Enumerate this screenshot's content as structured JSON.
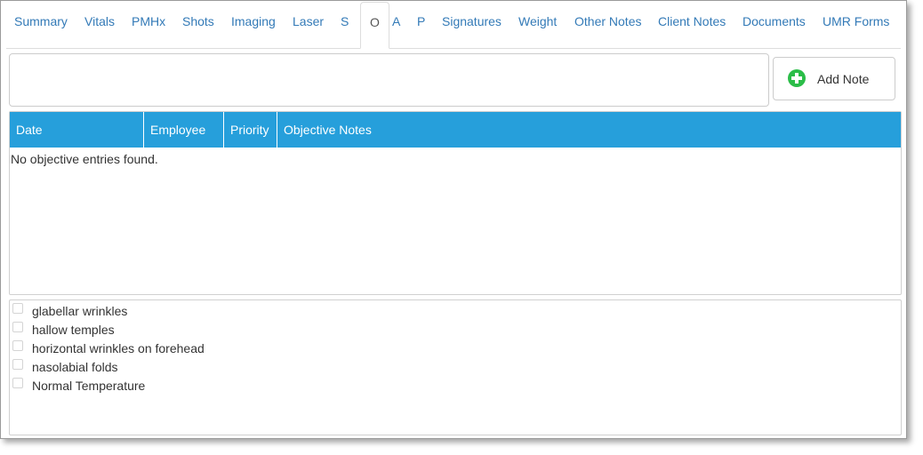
{
  "tabs": [
    {
      "label": "Summary",
      "active": false
    },
    {
      "label": "Vitals",
      "active": false
    },
    {
      "label": "PMHx",
      "active": false
    },
    {
      "label": "Shots",
      "active": false
    },
    {
      "label": "Imaging",
      "active": false
    },
    {
      "label": "Laser",
      "active": false
    },
    {
      "label": "S",
      "active": false
    },
    {
      "label": "O",
      "active": true
    },
    {
      "label": "A",
      "active": false
    },
    {
      "label": "P",
      "active": false
    },
    {
      "label": "Signatures",
      "active": false
    },
    {
      "label": "Weight",
      "active": false
    },
    {
      "label": "Other Notes",
      "active": false
    },
    {
      "label": "Client Notes",
      "active": false
    },
    {
      "label": "Documents",
      "active": false
    },
    {
      "label": "UMR Forms",
      "active": false
    }
  ],
  "note_input": {
    "value": "",
    "placeholder": ""
  },
  "add_note": {
    "label": "Add Note",
    "icon": "plus-circle-icon",
    "icon_color": "#2bbd48"
  },
  "table": {
    "header_color": "#269fdb",
    "columns": [
      "Date",
      "Employee",
      "Priority",
      "Objective Notes"
    ],
    "rows": [],
    "empty_message": "No objective entries found."
  },
  "checklist": {
    "items": [
      {
        "label": "glabellar wrinkles",
        "checked": false
      },
      {
        "label": "hallow temples",
        "checked": false
      },
      {
        "label": "horizontal wrinkles on forehead",
        "checked": false
      },
      {
        "label": "nasolabial folds",
        "checked": false
      },
      {
        "label": "Normal Temperature",
        "checked": false
      }
    ]
  },
  "colors": {
    "link": "#337ab7",
    "accent": "#269fdb"
  }
}
